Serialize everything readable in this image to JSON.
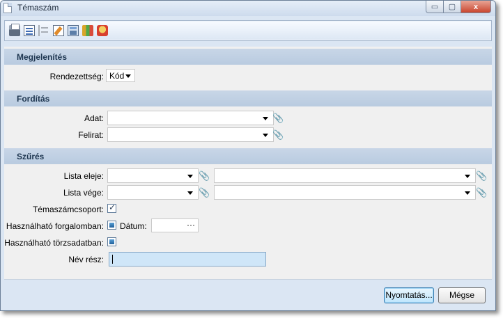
{
  "window": {
    "title": "Témaszám",
    "controls": {
      "minimize": "▭",
      "maximize": "▢",
      "close": "x"
    }
  },
  "toolbar": {
    "icons": [
      "print-icon",
      "print-preview-icon",
      "tree-icon",
      "edit-icon",
      "calculator-icon",
      "books-icon",
      "box-icon"
    ]
  },
  "sections": {
    "display": {
      "title": "Megjelenítés",
      "sort_label": "Rendezettség:",
      "sort_value": "Kód"
    },
    "translation": {
      "title": "Fordítás",
      "data_label": "Adat:",
      "caption_label": "Felirat:"
    },
    "filter": {
      "title": "Szűrés",
      "list_start_label": "Lista eleje:",
      "list_end_label": "Lista vége:",
      "group_label": "Témaszámcsoport:",
      "usable_in_transactions_label": "Használható forgalomban:",
      "date_label": "Dátum:",
      "date_button": "···",
      "usable_in_master_label": "Használható törzsadatban:",
      "name_part_label": "Név rész:"
    }
  },
  "buttons": {
    "print": "Nyomtatás...",
    "cancel": "Mégse"
  },
  "colors": {
    "section_header": "#bccde2",
    "window_bg": "#dbe6f3",
    "input_highlight": "#cfe6f8"
  }
}
